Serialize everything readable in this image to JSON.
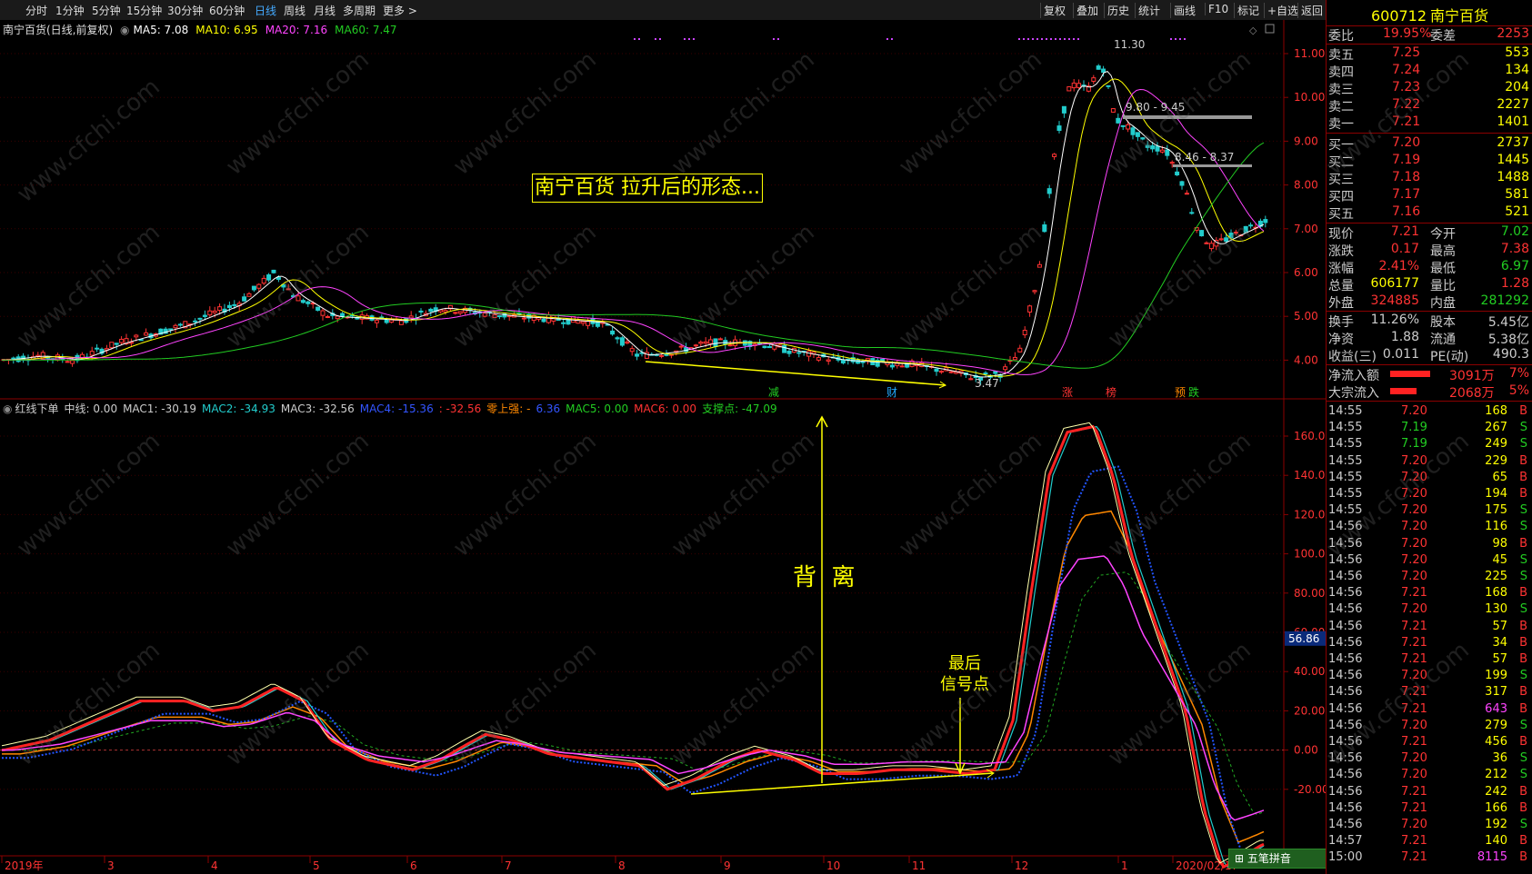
{
  "toolbar": {
    "periods": [
      "分时",
      "1分钟",
      "5分钟",
      "15分钟",
      "30分钟",
      "60分钟",
      "日线",
      "周线",
      "月线",
      "多周期",
      "更多 >"
    ],
    "active_period": "日线",
    "right_buttons": [
      "复权",
      "叠加",
      "历史",
      "统计",
      "画线",
      "F10",
      "标记",
      "+自选",
      "返回"
    ]
  },
  "stock": {
    "code": "600712",
    "name": "南宁百货"
  },
  "main_header": {
    "title": "南宁百货(日线,前复权)",
    "ma": [
      {
        "label": "MA5: 7.08",
        "color": "#ffffff"
      },
      {
        "label": "MA10: 6.95",
        "color": "#ffff00"
      },
      {
        "label": "MA20: 7.16",
        "color": "#ff44ff"
      },
      {
        "label": "MA60: 7.47",
        "color": "#22cc22"
      }
    ]
  },
  "annotation_title": "南宁百货 拉升后的形态...",
  "price_axis": [
    "11.00",
    "10.00",
    "9.00",
    "8.00",
    "7.00",
    "6.00",
    "5.00",
    "4.00"
  ],
  "price_labels": {
    "high": "11.30",
    "low": "3.47",
    "level1": "9.80 - 9.45",
    "level2": "8.46 - 8.37"
  },
  "event_markers": [
    "减",
    "财",
    "涨",
    "榜",
    "预",
    "跌"
  ],
  "sub_header": {
    "items": [
      {
        "label": "红线下单",
        "color": "#cccccc"
      },
      {
        "label": "中线: 0.00",
        "color": "#cccccc"
      },
      {
        "label": "MAC1: -30.19",
        "color": "#cccccc"
      },
      {
        "label": "MAC2: -34.93",
        "color": "#22cccc"
      },
      {
        "label": "MAC3: -32.56",
        "color": "#cccccc"
      },
      {
        "label": "MAC4: -15.36",
        "color": "#3355ff"
      },
      {
        "label": ": -32.56",
        "color": "#ff3333"
      },
      {
        "label": "零上强: -",
        "color": "#ff8800"
      },
      {
        "label": "6.36",
        "color": "#3355ff"
      },
      {
        "label": "MAC5: 0.00",
        "color": "#22cc22"
      },
      {
        "label": "MAC6: 0.00",
        "color": "#ff3333"
      },
      {
        "label": "支撑点: -47.09",
        "color": "#22cc22"
      }
    ]
  },
  "sub_axis": [
    "160.00",
    "140.00",
    "120.00",
    "100.00",
    "80.00",
    "60.00",
    "40.00",
    "20.00",
    "0.00",
    "-20.00"
  ],
  "sub_current": "56.86",
  "annotations": {
    "divergence": "背  离",
    "last_signal_line1": "最后",
    "last_signal_line2": "信号点"
  },
  "date_axis": [
    "2019年",
    "3",
    "4",
    "5",
    "6",
    "7",
    "8",
    "9",
    "10",
    "11",
    "12",
    "1",
    "2020/02/17"
  ],
  "ime": "五笔拼音",
  "quote": {
    "webi": {
      "label": "委比",
      "value": "19.95%",
      "label2": "委差",
      "value2": "2253"
    },
    "asks": [
      {
        "label": "卖五",
        "price": "7.25",
        "vol": "553"
      },
      {
        "label": "卖四",
        "price": "7.24",
        "vol": "134"
      },
      {
        "label": "卖三",
        "price": "7.23",
        "vol": "204"
      },
      {
        "label": "卖二",
        "price": "7.22",
        "vol": "2227"
      },
      {
        "label": "卖一",
        "price": "7.21",
        "vol": "1401"
      }
    ],
    "bids": [
      {
        "label": "买一",
        "price": "7.20",
        "vol": "2737"
      },
      {
        "label": "买二",
        "price": "7.19",
        "vol": "1445"
      },
      {
        "label": "买三",
        "price": "7.18",
        "vol": "1488"
      },
      {
        "label": "买四",
        "price": "7.17",
        "vol": "581"
      },
      {
        "label": "买五",
        "price": "7.16",
        "vol": "521"
      }
    ],
    "stats": [
      {
        "l1": "现价",
        "v1": "7.21",
        "c1": "#ff3333",
        "l2": "今开",
        "v2": "7.02",
        "c2": "#22cc22"
      },
      {
        "l1": "涨跌",
        "v1": "0.17",
        "c1": "#ff3333",
        "l2": "最高",
        "v2": "7.38",
        "c2": "#ff3333"
      },
      {
        "l1": "涨幅",
        "v1": "2.41%",
        "c1": "#ff3333",
        "l2": "最低",
        "v2": "6.97",
        "c2": "#22cc22"
      },
      {
        "l1": "总量",
        "v1": "606177",
        "c1": "#ffff00",
        "l2": "量比",
        "v2": "1.28",
        "c2": "#ff3333"
      },
      {
        "l1": "外盘",
        "v1": "324885",
        "c1": "#ff3333",
        "l2": "内盘",
        "v2": "281292",
        "c2": "#22cc22"
      }
    ],
    "stats2": [
      {
        "l1": "换手",
        "v1": "11.26%",
        "l2": "股本",
        "v2": "5.45亿"
      },
      {
        "l1": "净资",
        "v1": "1.88",
        "l2": "流通",
        "v2": "5.38亿"
      },
      {
        "l1": "收益(三)",
        "v1": "0.011",
        "l2": "PE(动)",
        "v2": "490.3"
      }
    ],
    "flows": [
      {
        "label": "净流入额",
        "value": "3091万",
        "pct": "7%",
        "bar": 0.75
      },
      {
        "label": "大宗流入",
        "value": "2068万",
        "pct": "5%",
        "bar": 0.5
      }
    ]
  },
  "ticks": [
    {
      "t": "14:55",
      "p": "7.20",
      "v": "168",
      "s": "B"
    },
    {
      "t": "14:55",
      "p": "7.19",
      "v": "267",
      "s": "S"
    },
    {
      "t": "14:55",
      "p": "7.19",
      "v": "249",
      "s": "S"
    },
    {
      "t": "14:55",
      "p": "7.20",
      "v": "229",
      "s": "B"
    },
    {
      "t": "14:55",
      "p": "7.20",
      "v": "65",
      "s": "B"
    },
    {
      "t": "14:55",
      "p": "7.20",
      "v": "194",
      "s": "B"
    },
    {
      "t": "14:55",
      "p": "7.20",
      "v": "175",
      "s": "S"
    },
    {
      "t": "14:56",
      "p": "7.20",
      "v": "116",
      "s": "S"
    },
    {
      "t": "14:56",
      "p": "7.20",
      "v": "98",
      "s": "B"
    },
    {
      "t": "14:56",
      "p": "7.20",
      "v": "45",
      "s": "S"
    },
    {
      "t": "14:56",
      "p": "7.20",
      "v": "225",
      "s": "S"
    },
    {
      "t": "14:56",
      "p": "7.21",
      "v": "168",
      "s": "B"
    },
    {
      "t": "14:56",
      "p": "7.20",
      "v": "130",
      "s": "S"
    },
    {
      "t": "14:56",
      "p": "7.21",
      "v": "57",
      "s": "B"
    },
    {
      "t": "14:56",
      "p": "7.21",
      "v": "34",
      "s": "B"
    },
    {
      "t": "14:56",
      "p": "7.21",
      "v": "57",
      "s": "B"
    },
    {
      "t": "14:56",
      "p": "7.20",
      "v": "199",
      "s": "S"
    },
    {
      "t": "14:56",
      "p": "7.21",
      "v": "317",
      "s": "B"
    },
    {
      "t": "14:56",
      "p": "7.21",
      "v": "643",
      "s": "B"
    },
    {
      "t": "14:56",
      "p": "7.20",
      "v": "279",
      "s": "S"
    },
    {
      "t": "14:56",
      "p": "7.21",
      "v": "456",
      "s": "B"
    },
    {
      "t": "14:56",
      "p": "7.20",
      "v": "36",
      "s": "S"
    },
    {
      "t": "14:56",
      "p": "7.20",
      "v": "212",
      "s": "S"
    },
    {
      "t": "14:56",
      "p": "7.21",
      "v": "242",
      "s": "B"
    },
    {
      "t": "14:56",
      "p": "7.21",
      "v": "166",
      "s": "B"
    },
    {
      "t": "14:56",
      "p": "7.20",
      "v": "192",
      "s": "S"
    },
    {
      "t": "14:57",
      "p": "7.21",
      "v": "140",
      "s": "B"
    },
    {
      "t": "15:00",
      "p": "7.21",
      "v": "8115",
      "s": "B"
    }
  ],
  "watermark": "www.cfchi.com"
}
